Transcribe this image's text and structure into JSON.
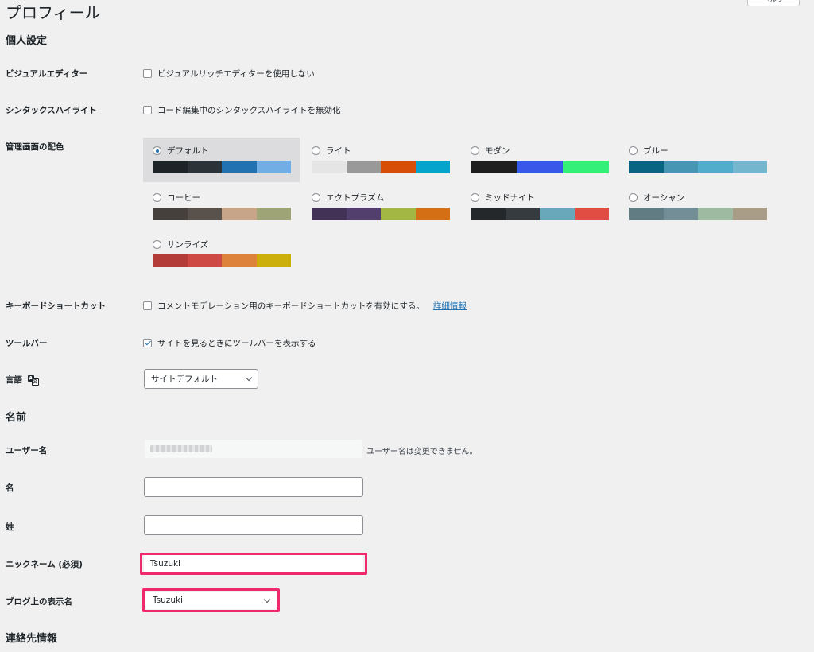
{
  "page": {
    "title": "プロフィール",
    "help_label": "ヘルプ"
  },
  "personal": {
    "heading": "個人設定",
    "visual_editor": {
      "label": "ビジュアルエディター",
      "option": "ビジュアルリッチエディターを使用しない",
      "checked": false
    },
    "syntax_highlight": {
      "label": "シンタックスハイライト",
      "option": "コード編集中のシンタックスハイライトを無効化",
      "checked": false
    },
    "color_scheme": {
      "label": "管理画面の配色",
      "selected": "default",
      "schemes": [
        {
          "id": "default",
          "name": "デフォルト",
          "colors": [
            "#1d2327",
            "#2c3338",
            "#2271b1",
            "#72aee6"
          ]
        },
        {
          "id": "light",
          "name": "ライト",
          "colors": [
            "#e5e5e5",
            "#999999",
            "#d64e07",
            "#04a4cc"
          ]
        },
        {
          "id": "modern",
          "name": "モダン",
          "colors": [
            "#1e1e1e",
            "#3858e9",
            "#33f078"
          ]
        },
        {
          "id": "blue",
          "name": "ブルー",
          "colors": [
            "#096484",
            "#4796b3",
            "#52accc",
            "#74b6ce"
          ]
        },
        {
          "id": "coffee",
          "name": "コーヒー",
          "colors": [
            "#46403c",
            "#59524c",
            "#c7a589",
            "#9ea476"
          ]
        },
        {
          "id": "ectoplasm",
          "name": "エクトプラズム",
          "colors": [
            "#413256",
            "#523f6d",
            "#a3b745",
            "#d46f15"
          ]
        },
        {
          "id": "midnight",
          "name": "ミッドナイト",
          "colors": [
            "#25282b",
            "#363b3f",
            "#69a8bb",
            "#e14d43"
          ]
        },
        {
          "id": "ocean",
          "name": "オーシャン",
          "colors": [
            "#627c83",
            "#738e96",
            "#9ebaa0",
            "#aa9d88"
          ]
        },
        {
          "id": "sunrise",
          "name": "サンライズ",
          "colors": [
            "#b43c38",
            "#cf4944",
            "#dd823b",
            "#ccaf0b"
          ]
        }
      ]
    },
    "keyboard_shortcuts": {
      "label": "キーボードショートカット",
      "option": "コメントモデレーション用のキーボードショートカットを有効にする。",
      "link": "詳細情報",
      "checked": false
    },
    "toolbar": {
      "label": "ツールバー",
      "option": "サイトを見るときにツールバーを表示する",
      "checked": true
    },
    "language": {
      "label": "言語",
      "value": "サイトデフォルト"
    }
  },
  "name": {
    "heading": "名前",
    "username": {
      "label": "ユーザー名",
      "note": "ユーザー名は変更できません。"
    },
    "first_name": {
      "label": "名",
      "value": ""
    },
    "last_name": {
      "label": "姓",
      "value": ""
    },
    "nickname": {
      "label": "ニックネーム (必須)",
      "value": "Tsuzuki"
    },
    "display_name": {
      "label": "ブログ上の表示名",
      "value": "Tsuzuki"
    }
  },
  "contact": {
    "heading": "連絡先情報"
  },
  "colors": {
    "highlight": "#f0286e",
    "accent": "#2271b1"
  }
}
